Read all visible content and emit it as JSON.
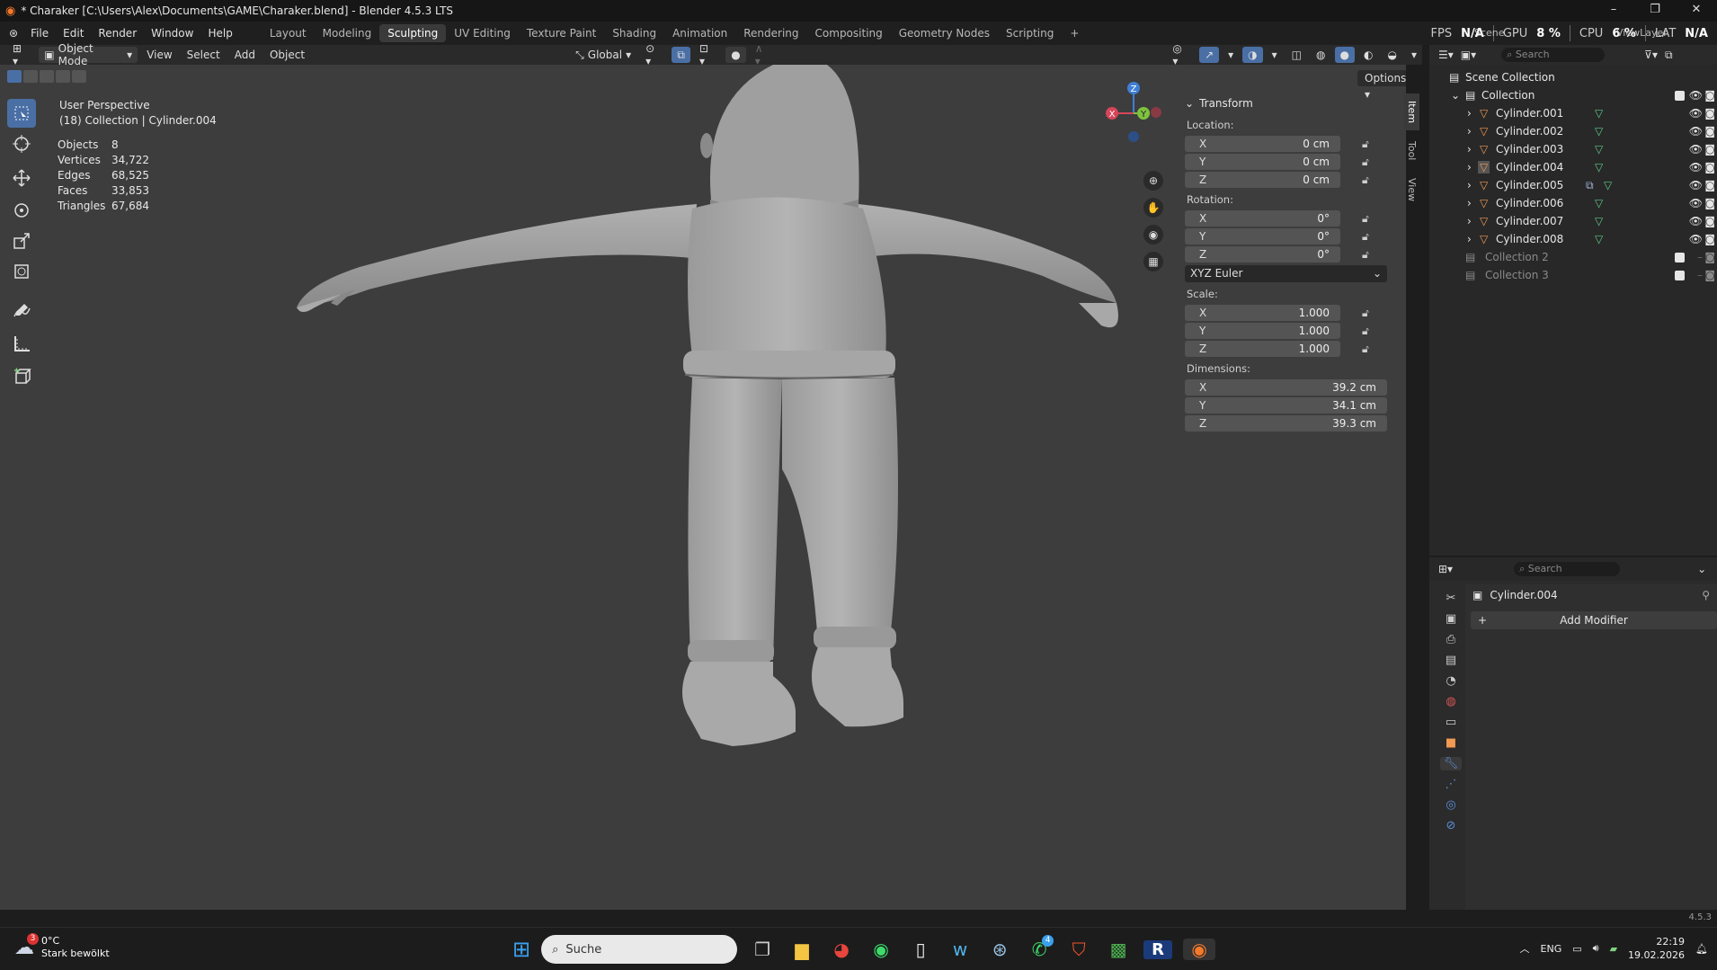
{
  "window": {
    "title": "* Charaker [C:\\Users\\Alex\\Documents\\GAME\\Charaker.blend] - Blender 4.5.3 LTS",
    "minimize": "–",
    "maximize": "❐",
    "close": "✕"
  },
  "menu": [
    "File",
    "Edit",
    "Render",
    "Window",
    "Help"
  ],
  "workspaces": [
    "Layout",
    "Modeling",
    "Sculpting",
    "UV Editing",
    "Texture Paint",
    "Shading",
    "Animation",
    "Rendering",
    "Compositing",
    "Geometry Nodes",
    "Scripting"
  ],
  "active_workspace": "Sculpting",
  "add_workspace": "+",
  "perf": {
    "fps_label": "FPS",
    "fps": "N/A",
    "gpu_label": "GPU",
    "gpu": "8 %",
    "cpu_label": "CPU",
    "cpu": "6 %",
    "lat_label": "LAT",
    "lat": "N/A"
  },
  "scene": {
    "name": "Scene",
    "view_layer": "ViewLayer"
  },
  "viewport_header": {
    "mode": "Object Mode",
    "menus": [
      "View",
      "Select",
      "Add",
      "Object"
    ],
    "orientation": "Global",
    "options": "Options"
  },
  "overlay": {
    "perspective": "User Perspective",
    "collection_line": "(18) Collection | Cylinder.004",
    "stats": [
      {
        "k": "Objects",
        "v": "8"
      },
      {
        "k": "Vertices",
        "v": "34,722"
      },
      {
        "k": "Edges",
        "v": "68,525"
      },
      {
        "k": "Faces",
        "v": "33,853"
      },
      {
        "k": "Triangles",
        "v": "67,684"
      }
    ]
  },
  "gizmo": {
    "z": "Z",
    "y": "Y",
    "x": "X"
  },
  "npanel": {
    "title": "Transform",
    "tabs": [
      "Item",
      "Tool",
      "View"
    ],
    "location_label": "Location:",
    "location": [
      {
        "axis": "X",
        "value": "0 cm"
      },
      {
        "axis": "Y",
        "value": "0 cm"
      },
      {
        "axis": "Z",
        "value": "0 cm"
      }
    ],
    "rotation_label": "Rotation:",
    "rotation": [
      {
        "axis": "X",
        "value": "0°"
      },
      {
        "axis": "Y",
        "value": "0°"
      },
      {
        "axis": "Z",
        "value": "0°"
      }
    ],
    "rotation_mode": "XYZ Euler",
    "scale_label": "Scale:",
    "scale": [
      {
        "axis": "X",
        "value": "1.000"
      },
      {
        "axis": "Y",
        "value": "1.000"
      },
      {
        "axis": "Z",
        "value": "1.000"
      }
    ],
    "dimensions_label": "Dimensions:",
    "dimensions": [
      {
        "axis": "X",
        "value": "39.2 cm"
      },
      {
        "axis": "Y",
        "value": "34.1 cm"
      },
      {
        "axis": "Z",
        "value": "39.3 cm"
      }
    ]
  },
  "outliner": {
    "search_placeholder": "Search",
    "scene_collection": "Scene Collection",
    "collection": "Collection",
    "objects": [
      "Cylinder.001",
      "Cylinder.002",
      "Cylinder.003",
      "Cylinder.004",
      "Cylinder.005",
      "Cylinder.006",
      "Cylinder.007",
      "Cylinder.008"
    ],
    "selected": "Cylinder.004",
    "other_collections": [
      "Collection 2",
      "Collection 3"
    ]
  },
  "properties": {
    "search_placeholder": "Search",
    "object_name": "Cylinder.004",
    "add_modifier": "Add Modifier"
  },
  "version": "4.5.3",
  "taskbar": {
    "weather_temp": "0°C",
    "weather_desc": "Stark bewölkt",
    "weather_badge": "3",
    "search_placeholder": "Suche",
    "whatsapp_badge": "4",
    "lang": "ENG",
    "time": "22:19",
    "date": "19.02.2026"
  }
}
